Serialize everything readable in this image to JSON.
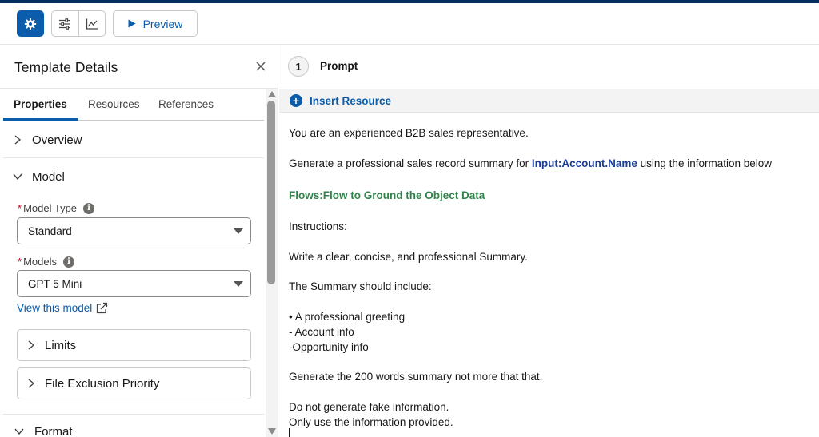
{
  "toolbar": {
    "buttons": [
      {
        "name": "settings",
        "icon": "gear-icon",
        "active": true
      },
      {
        "name": "adjust",
        "icon": "sliders-icon"
      },
      {
        "name": "analytics",
        "icon": "chart-icon"
      }
    ],
    "preview_label": "Preview"
  },
  "left_panel": {
    "title": "Template Details",
    "tabs": [
      {
        "label": "Properties",
        "active": true
      },
      {
        "label": "Resources",
        "active": false
      },
      {
        "label": "References",
        "active": false
      }
    ],
    "sections": {
      "overview": {
        "label": "Overview",
        "expanded": false
      },
      "model": {
        "label": "Model",
        "expanded": true,
        "model_type": {
          "label": "Model Type",
          "required_mark": "*",
          "value": "Standard"
        },
        "models": {
          "label": "Models",
          "required_mark": "*",
          "value": "GPT 5 Mini"
        },
        "view_link": "View this model",
        "limits": {
          "label": "Limits"
        },
        "file_exclusion": {
          "label": "File Exclusion Priority"
        }
      },
      "format": {
        "label": "Format"
      }
    }
  },
  "right_panel": {
    "step_number": "1",
    "step_title": "Prompt",
    "insert_resource_label": "Insert Resource",
    "prompt": {
      "line1": "You are an experienced B2B sales representative.",
      "line2_pre": "Generate a professional sales record summary for ",
      "line2_token": "Input:Account.Name",
      "line2_post": " using the information below",
      "line3_token": "Flows:Flow to Ground the Object Data",
      "line4": "Instructions:",
      "line5": "Write a clear, concise, and professional Summary.",
      "line6": "The Summary should include:",
      "line7": "• A professional greeting",
      "line8": "- Account info",
      "line9": "-Opportunity info",
      "line10": "Generate the 200 words summary not more that that.",
      "line11": "Do not generate fake information.",
      "line12": "Only use the information provided."
    }
  },
  "colors": {
    "brand": "#0b5cab",
    "topline": "#032d60",
    "input_token": "#1a3e9c",
    "flow_token": "#2e844a",
    "required": "#ba0517"
  }
}
